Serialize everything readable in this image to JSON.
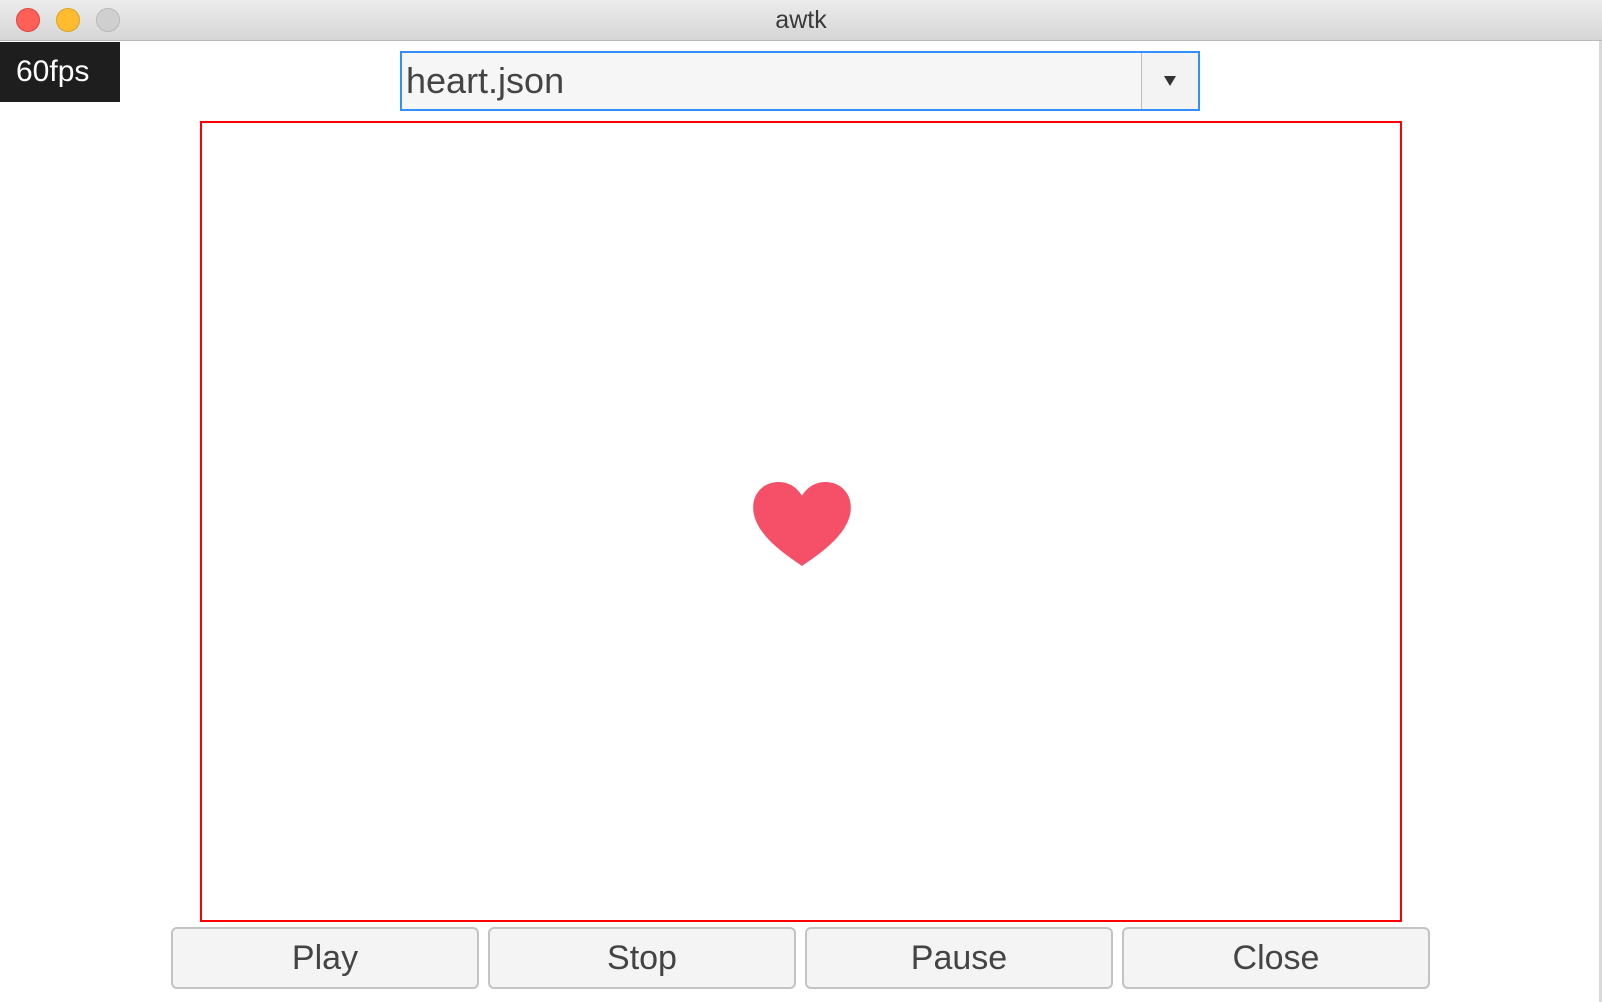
{
  "window": {
    "title": "awtk"
  },
  "fps": {
    "label": "60fps"
  },
  "combo": {
    "value": "heart.json",
    "dropdown_icon": "triangle-down-icon"
  },
  "canvas": {
    "content_icon": "heart-icon",
    "heart_color": "#f55068",
    "border_color": "#ff0000"
  },
  "controls": {
    "play_label": "Play",
    "stop_label": "Stop",
    "pause_label": "Pause",
    "close_label": "Close"
  },
  "colors": {
    "combo_focus_border": "#338fff",
    "fps_background": "#1e1e1e"
  }
}
